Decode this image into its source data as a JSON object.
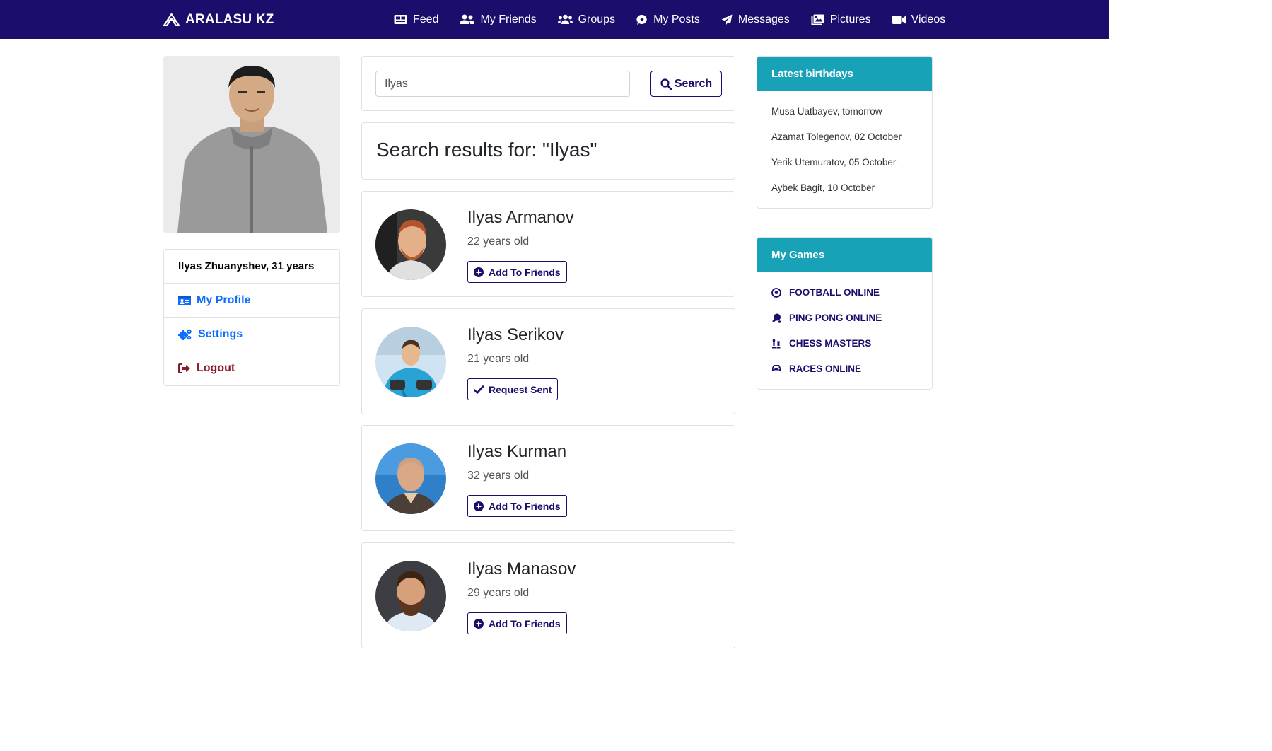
{
  "brand": {
    "name": "ARALASU KZ",
    "icon": "brand-logo-icon"
  },
  "nav": [
    {
      "label": "Feed",
      "icon": "newspaper-icon"
    },
    {
      "label": "My Friends",
      "icon": "user-friends-icon"
    },
    {
      "label": "Groups",
      "icon": "users-icon"
    },
    {
      "label": "My Posts",
      "icon": "comment-icon"
    },
    {
      "label": "Messages",
      "icon": "paper-plane-icon"
    },
    {
      "label": "Pictures",
      "icon": "images-icon"
    },
    {
      "label": "Videos",
      "icon": "video-icon"
    }
  ],
  "sidebar": {
    "user_label": "Ilyas Zhuanyshev, 31 years",
    "items": [
      {
        "label": "My Profile",
        "icon": "id-card-icon"
      },
      {
        "label": "Settings",
        "icon": "cogs-icon"
      },
      {
        "label": "Logout",
        "icon": "sign-out-icon"
      }
    ]
  },
  "search": {
    "value": "Ilyas",
    "button_label": "Search",
    "results_title": "Search results for: \"Ilyas\""
  },
  "results": [
    {
      "name": "Ilyas Armanov",
      "age": "22 years old",
      "action": "Add To Friends",
      "action_icon": "plus-circle-icon"
    },
    {
      "name": "Ilyas Serikov",
      "age": "21 years old",
      "action": "Request Sent",
      "action_icon": "check-icon"
    },
    {
      "name": "Ilyas Kurman",
      "age": "32 years old",
      "action": "Add To Friends",
      "action_icon": "plus-circle-icon"
    },
    {
      "name": "Ilyas Manasov",
      "age": "29 years old",
      "action": "Add To Friends",
      "action_icon": "plus-circle-icon"
    }
  ],
  "birthdays": {
    "title": "Latest birthdays",
    "items": [
      "Musa Uatbayev, tomorrow",
      "Azamat Tolegenov, 02 October",
      "Yerik Utemuratov, 05 October",
      "Aybek Bagit, 10 October"
    ]
  },
  "games": {
    "title": "My Games",
    "items": [
      {
        "label": "FOOTBALL ONLINE",
        "icon": "futbol-icon"
      },
      {
        "label": "PING PONG ONLINE",
        "icon": "table-tennis-icon"
      },
      {
        "label": "CHESS MASTERS",
        "icon": "chess-icon"
      },
      {
        "label": "RACES ONLINE",
        "icon": "car-icon"
      }
    ]
  },
  "colors": {
    "navbar": "#1a0d6b",
    "accent": "#17a2b8",
    "link_blue": "#0d6efd",
    "logout_red": "#8b1a2b"
  }
}
